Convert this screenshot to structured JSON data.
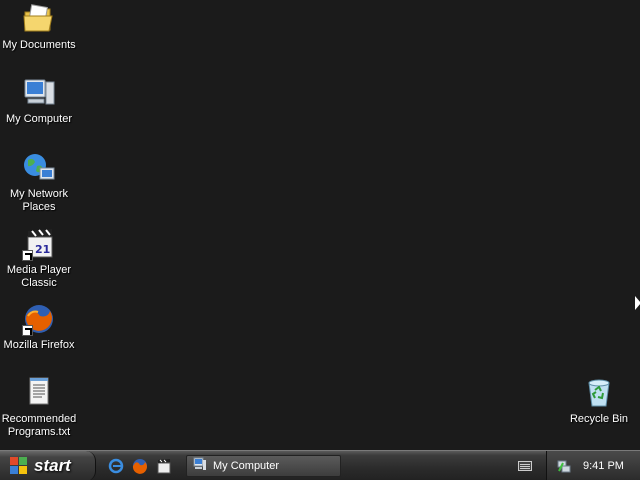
{
  "desktop": {
    "icons": [
      {
        "label": "My Documents",
        "icon": "folder-documents-icon"
      },
      {
        "label": "My Computer",
        "icon": "computer-icon"
      },
      {
        "label": "My Network\nPlaces",
        "icon": "network-globe-icon"
      },
      {
        "label": "Media Player\nClassic",
        "icon": "media-player-icon"
      },
      {
        "label": "Mozilla Firefox",
        "icon": "firefox-icon"
      },
      {
        "label": "Recommended\nPrograms.txt",
        "icon": "text-file-icon"
      },
      {
        "label": "Recycle Bin",
        "icon": "recycle-bin-icon"
      }
    ]
  },
  "taskbar": {
    "start_label": "start",
    "quick_launch": [
      "internet-explorer-icon",
      "firefox-icon",
      "media-player-icon"
    ],
    "task_buttons": [
      {
        "label": "My Computer",
        "icon": "computer-icon"
      }
    ],
    "tray_icons": [
      "keyboard-icon",
      "network-tray-icon"
    ],
    "clock": "9:41 PM"
  },
  "colors": {
    "desktop_background": "#1b1b1b",
    "taskbar": "#2b2b2b",
    "text": "#ffffff"
  }
}
